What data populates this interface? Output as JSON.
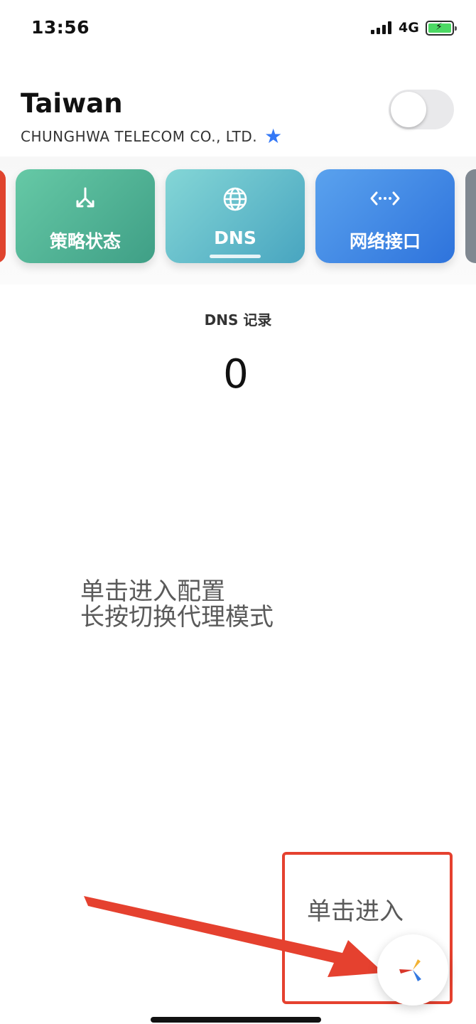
{
  "status_bar": {
    "time": "13:56",
    "network_type": "4G",
    "battery_level": 1.0
  },
  "header": {
    "title": "Taiwan",
    "subtitle": "CHUNGHWA TELECOM CO., LTD.",
    "star_icon": "star-icon",
    "proxy_toggle_on": false
  },
  "cards": [
    {
      "label": "策略状态",
      "icon": "policy-fork-icon"
    },
    {
      "label": "DNS",
      "icon": "globe-icon",
      "selected": true
    },
    {
      "label": "网络接口",
      "icon": "network-interface-icon"
    }
  ],
  "dns": {
    "label": "DNS 记录",
    "count": "0"
  },
  "instructions": {
    "line1": "单击进入配置",
    "line2": "长按切换代理模式"
  },
  "annotation": {
    "label": "单击进入",
    "color": "#e5412f"
  },
  "fab": {
    "icon": "pinwheel-icon"
  }
}
